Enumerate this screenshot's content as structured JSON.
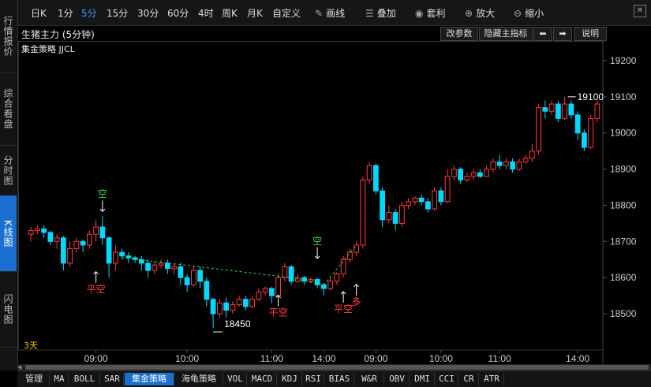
{
  "left_nav": [
    {
      "label": "行情报价",
      "active": false
    },
    {
      "label": "综合看盘",
      "active": false
    },
    {
      "label": "分时图",
      "active": false
    },
    {
      "label": "K线图",
      "active": true
    },
    {
      "label": "闪电图",
      "active": false
    }
  ],
  "toolbar": {
    "periods": [
      "日K",
      "1分",
      "5分",
      "15分",
      "30分",
      "60分",
      "4时",
      "周K",
      "月K",
      "自定义"
    ],
    "selected_period": "5分",
    "draw_label": "画线",
    "overlay_label": "叠加",
    "arbitrage_label": "套利",
    "zoom_in_label": "放大",
    "zoom_out_label": "缩小",
    "icons": {
      "draw": "pencil-icon",
      "overlay": "database-icon",
      "arbitrage": "moneybag-icon",
      "zoom_in": "zoom-in-icon",
      "zoom_out": "zoom-out-icon",
      "close": "close-icon"
    }
  },
  "header": {
    "title": "生猪主力 (5分钟)",
    "modify_params": "改参数",
    "hide_main_indicator": "隐藏主指标",
    "explain": "说明"
  },
  "strategy_label": "集金策略 JJCL",
  "period_text": "3天",
  "price_axis": [
    "19200",
    "19100",
    "19000",
    "18900",
    "18800",
    "18700",
    "18600",
    "18500"
  ],
  "time_axis": [
    "09:00",
    "10:00",
    "11:00",
    "14:00",
    "09:00",
    "10:00",
    "11:00",
    "14:00"
  ],
  "annotations": {
    "high_label": "19100",
    "low_label": "18450",
    "signals": [
      {
        "text": "空",
        "type": "short"
      },
      {
        "text": "平空",
        "type": "cover"
      },
      {
        "text": "平空",
        "type": "cover"
      },
      {
        "text": "空",
        "type": "short"
      },
      {
        "text": "平空",
        "type": "cover"
      },
      {
        "text": "多",
        "type": "long"
      }
    ]
  },
  "bottom_tabs": [
    "管理",
    "MA",
    "BOLL",
    "SAR",
    "集金策略",
    "海龟策略",
    "VOL",
    "MACD",
    "KDJ",
    "RSI",
    "BIAS",
    "W&R",
    "OBV",
    "DMI",
    "CCI",
    "CR",
    "ATR"
  ],
  "active_bottom_tab": "集金策略",
  "colors": {
    "up": "#ff3b3b",
    "down": "#00d8ff",
    "signal_short": "#35d435",
    "signal_cover": "#ff4040",
    "axis_text": "#cccccc",
    "active": "#1a6fd0"
  },
  "chart_data": {
    "type": "candlestick",
    "ylim": [
      18400,
      19250
    ],
    "candles": [
      [
        18720,
        18730,
        18700,
        18740
      ],
      [
        18730,
        18735,
        18720,
        18745
      ],
      [
        18735,
        18725,
        18710,
        18745
      ],
      [
        18725,
        18700,
        18690,
        18730
      ],
      [
        18700,
        18710,
        18680,
        18720
      ],
      [
        18710,
        18640,
        18620,
        18715
      ],
      [
        18640,
        18680,
        18630,
        18700
      ],
      [
        18680,
        18700,
        18670,
        18710
      ],
      [
        18700,
        18690,
        18670,
        18705
      ],
      [
        18690,
        18720,
        18680,
        18730
      ],
      [
        18720,
        18740,
        18700,
        18760
      ],
      [
        18740,
        18710,
        18690,
        18770
      ],
      [
        18710,
        18640,
        18600,
        18715
      ],
      [
        18640,
        18670,
        18620,
        18690
      ],
      [
        18670,
        18660,
        18650,
        18680
      ],
      [
        18660,
        18655,
        18640,
        18670
      ],
      [
        18655,
        18650,
        18640,
        18660
      ],
      [
        18650,
        18640,
        18620,
        18660
      ],
      [
        18640,
        18620,
        18600,
        18650
      ],
      [
        18620,
        18635,
        18610,
        18645
      ],
      [
        18635,
        18640,
        18625,
        18650
      ],
      [
        18640,
        18625,
        18610,
        18650
      ],
      [
        18625,
        18630,
        18610,
        18640
      ],
      [
        18630,
        18600,
        18580,
        18640
      ],
      [
        18600,
        18580,
        18560,
        18610
      ],
      [
        18580,
        18620,
        18575,
        18630
      ],
      [
        18620,
        18590,
        18570,
        18630
      ],
      [
        18590,
        18540,
        18520,
        18600
      ],
      [
        18540,
        18500,
        18460,
        18545
      ],
      [
        18500,
        18530,
        18490,
        18540
      ],
      [
        18530,
        18510,
        18490,
        18545
      ],
      [
        18510,
        18525,
        18500,
        18535
      ],
      [
        18525,
        18540,
        18520,
        18550
      ],
      [
        18540,
        18520,
        18510,
        18550
      ],
      [
        18520,
        18540,
        18515,
        18550
      ],
      [
        18540,
        18560,
        18535,
        18570
      ],
      [
        18560,
        18570,
        18550,
        18575
      ],
      [
        18570,
        18550,
        18530,
        18575
      ],
      [
        18550,
        18600,
        18545,
        18610
      ],
      [
        18600,
        18630,
        18590,
        18640
      ],
      [
        18630,
        18590,
        18580,
        18635
      ],
      [
        18590,
        18600,
        18585,
        18610
      ],
      [
        18600,
        18590,
        18580,
        18605
      ],
      [
        18590,
        18595,
        18585,
        18600
      ],
      [
        18595,
        18580,
        18570,
        18600
      ],
      [
        18580,
        18570,
        18550,
        18585
      ],
      [
        18570,
        18590,
        18565,
        18600
      ],
      [
        18590,
        18610,
        18580,
        18615
      ],
      [
        18610,
        18650,
        18600,
        18660
      ],
      [
        18650,
        18670,
        18640,
        18680
      ],
      [
        18670,
        18690,
        18660,
        18700
      ],
      [
        18690,
        18870,
        18680,
        18880
      ],
      [
        18870,
        18910,
        18860,
        18920
      ],
      [
        18910,
        18840,
        18830,
        18915
      ],
      [
        18840,
        18760,
        18740,
        18850
      ],
      [
        18760,
        18780,
        18750,
        18800
      ],
      [
        18780,
        18750,
        18730,
        18790
      ],
      [
        18750,
        18800,
        18740,
        18810
      ],
      [
        18800,
        18810,
        18790,
        18820
      ],
      [
        18810,
        18820,
        18800,
        18825
      ],
      [
        18820,
        18810,
        18800,
        18830
      ],
      [
        18810,
        18790,
        18780,
        18820
      ],
      [
        18790,
        18840,
        18785,
        18850
      ],
      [
        18840,
        18810,
        18800,
        18850
      ],
      [
        18810,
        18880,
        18805,
        18900
      ],
      [
        18880,
        18900,
        18870,
        18910
      ],
      [
        18900,
        18870,
        18860,
        18905
      ],
      [
        18870,
        18880,
        18865,
        18890
      ],
      [
        18880,
        18890,
        18870,
        18900
      ],
      [
        18890,
        18880,
        18875,
        18900
      ],
      [
        18880,
        18900,
        18880,
        18910
      ],
      [
        18900,
        18920,
        18890,
        18930
      ],
      [
        18920,
        18910,
        18900,
        18940
      ],
      [
        18910,
        18920,
        18900,
        18930
      ],
      [
        18920,
        18900,
        18890,
        18930
      ],
      [
        18900,
        18920,
        18895,
        18930
      ],
      [
        18920,
        18930,
        18915,
        18940
      ],
      [
        18930,
        18950,
        18920,
        18970
      ],
      [
        18950,
        19070,
        18940,
        19080
      ],
      [
        19070,
        19060,
        19040,
        19090
      ],
      [
        19060,
        19080,
        19050,
        19090
      ],
      [
        19080,
        19040,
        19030,
        19090
      ],
      [
        19040,
        19080,
        19035,
        19100
      ],
      [
        19080,
        19050,
        19040,
        19090
      ],
      [
        19050,
        19000,
        18980,
        19060
      ],
      [
        19000,
        18960,
        18950,
        19010
      ],
      [
        18960,
        19040,
        18955,
        19050
      ],
      [
        19040,
        19080,
        19030,
        19090
      ]
    ]
  }
}
